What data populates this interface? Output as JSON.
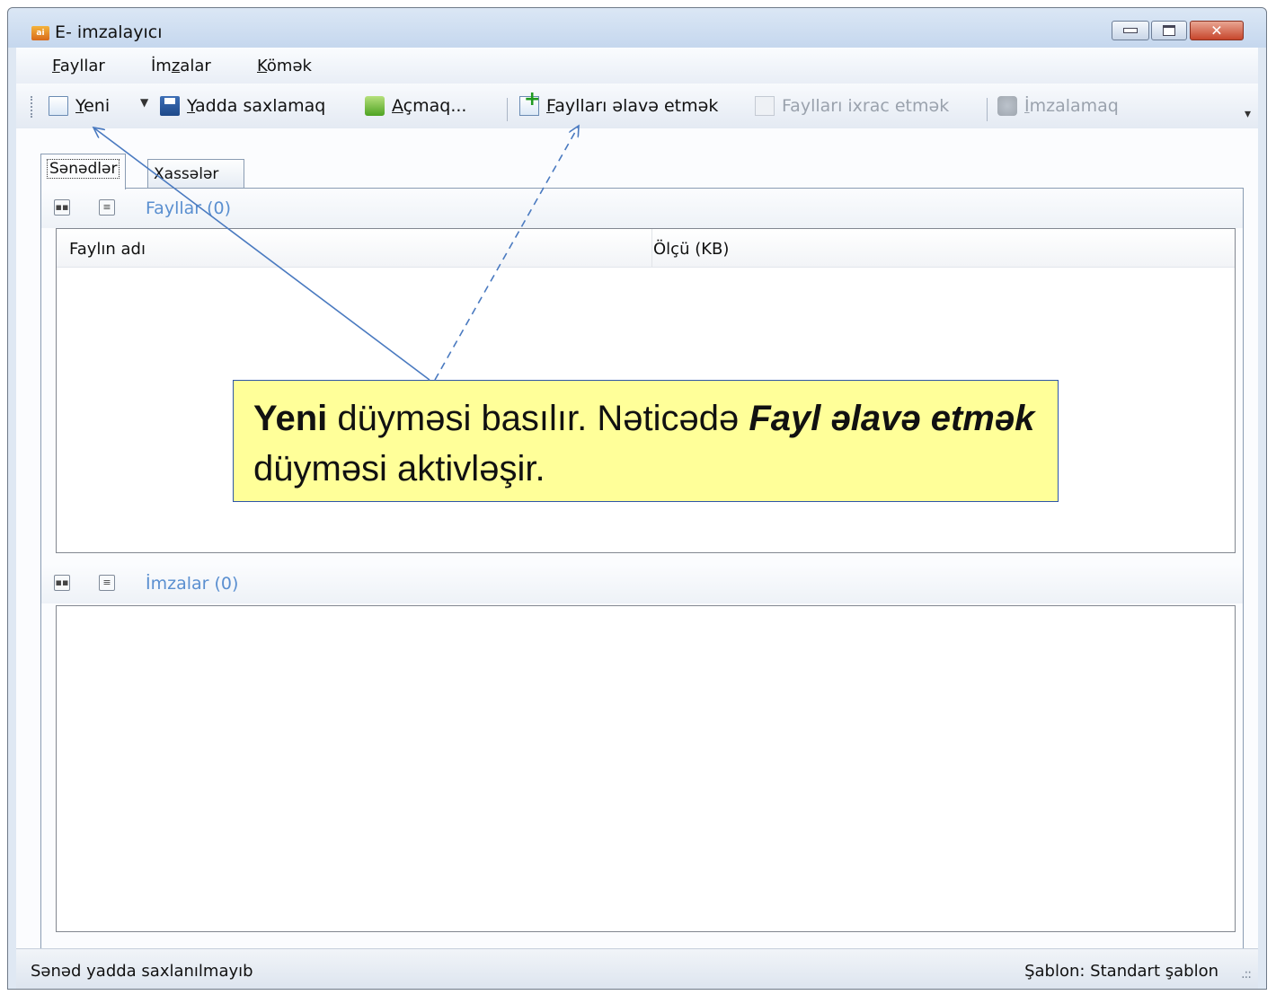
{
  "window": {
    "title": "E- imzalayıcı",
    "buttons": {
      "minimize": "minimize-icon",
      "maximize": "maximize-icon",
      "close": "close-icon"
    }
  },
  "menu": [
    {
      "label": "Fayllar",
      "underline": "F",
      "rest": "ayllar"
    },
    {
      "label": "İmzalar",
      "before": "İm",
      "underline": "z",
      "rest": "alar"
    },
    {
      "label": "Kömək",
      "underline": "K",
      "rest": "ömək"
    }
  ],
  "toolbar": {
    "new": {
      "underline": "Y",
      "rest": "eni",
      "icon": "new-document-icon"
    },
    "save": {
      "underline": "Y",
      "rest": "adda saxlamaq",
      "icon": "save-icon"
    },
    "open": {
      "underline": "A",
      "rest": "çmaq...",
      "icon": "open-icon"
    },
    "add_files": {
      "underline": "F",
      "rest": "aylları əlavə etmək",
      "icon": "add-file-icon"
    },
    "export_files": {
      "label": "Faylları ixrac etmək",
      "icon": "export-icon",
      "enabled": false
    },
    "sign": {
      "underline": "İ",
      "rest": "mzalamaq",
      "icon": "sign-icon",
      "enabled": false
    }
  },
  "tabs": {
    "documents": "Sənədlər",
    "properties": "Xassələr"
  },
  "files_section": {
    "title": "Fayllar (0)",
    "columns": [
      "Faylın adı",
      "Ölçü (KB)"
    ]
  },
  "signatures_section": {
    "title": "İmzalar (0)"
  },
  "status": {
    "left": "Sənəd yadda saxlanılmayıb",
    "right": "Şablon: Standart şablon"
  },
  "callout": {
    "bold": "Yeni",
    "text1": " düyməsi basılır. Nəticədə ",
    "bold_italic": "Fayl əlavə etmək",
    "text2": " düyməsi aktivləşir."
  }
}
